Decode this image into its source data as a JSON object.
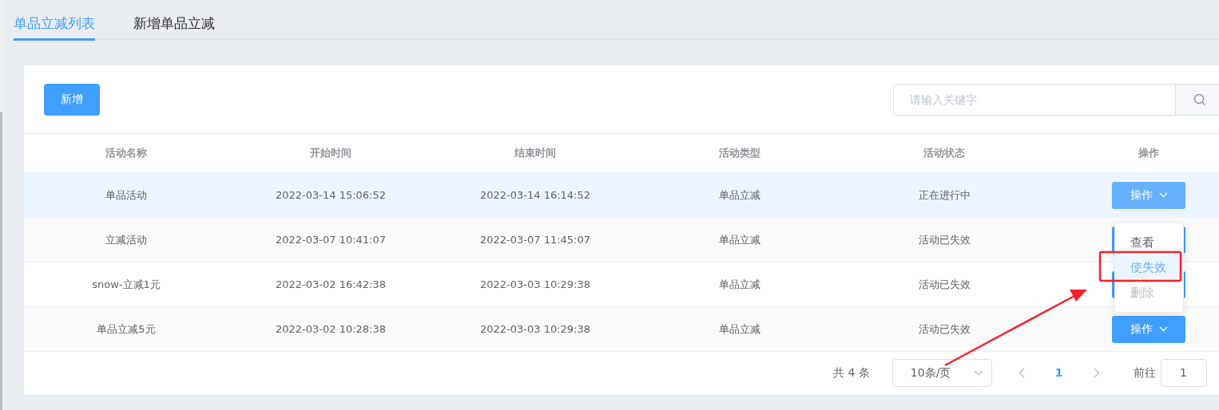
{
  "tabs": [
    {
      "label": "单品立减列表",
      "selected": true
    },
    {
      "label": "新增单品立减",
      "selected": false
    }
  ],
  "toolbar": {
    "add_button": "新增",
    "search": {
      "placeholder": "请输入关键字"
    }
  },
  "table": {
    "columns": [
      "活动名称",
      "开始时间",
      "结束时间",
      "活动类型",
      "活动状态",
      "操作"
    ],
    "rows": [
      {
        "cells": [
          "单品活动",
          "2022-03-14 15:06:52",
          "2022-03-14 16:14:52",
          "单品立减",
          "正在进行中"
        ],
        "action": "操作",
        "hovered": true
      },
      {
        "cells": [
          "立减活动",
          "2022-03-07 10:41:07",
          "2022-03-07 11:45:07",
          "单品立减",
          "活动已失效"
        ],
        "hovered": false
      },
      {
        "cells": [
          "snow-立减1元",
          "2022-03-02 16:42:38",
          "2022-03-03 10:29:38",
          "单品立减",
          "活动已失效"
        ],
        "hovered": false
      },
      {
        "cells": [
          "单品立减5元",
          "2022-03-02 10:28:38",
          "2022-03-03 10:29:38",
          "单品立减",
          "活动已失效"
        ],
        "action": "操作",
        "hovered": false
      }
    ]
  },
  "dropdown_menu": {
    "items": [
      {
        "label": "查看",
        "hovered": false,
        "disabled": false
      },
      {
        "label": "使失效",
        "hovered": true,
        "disabled": false
      },
      {
        "label": "删除",
        "hovered": false,
        "disabled": true
      }
    ]
  },
  "pagination": {
    "total": "共 4 条",
    "page_size": "10条/页",
    "pages": [
      {
        "label": "1",
        "selected": true
      }
    ],
    "goto_label": "前往",
    "goto_value": "1"
  }
}
